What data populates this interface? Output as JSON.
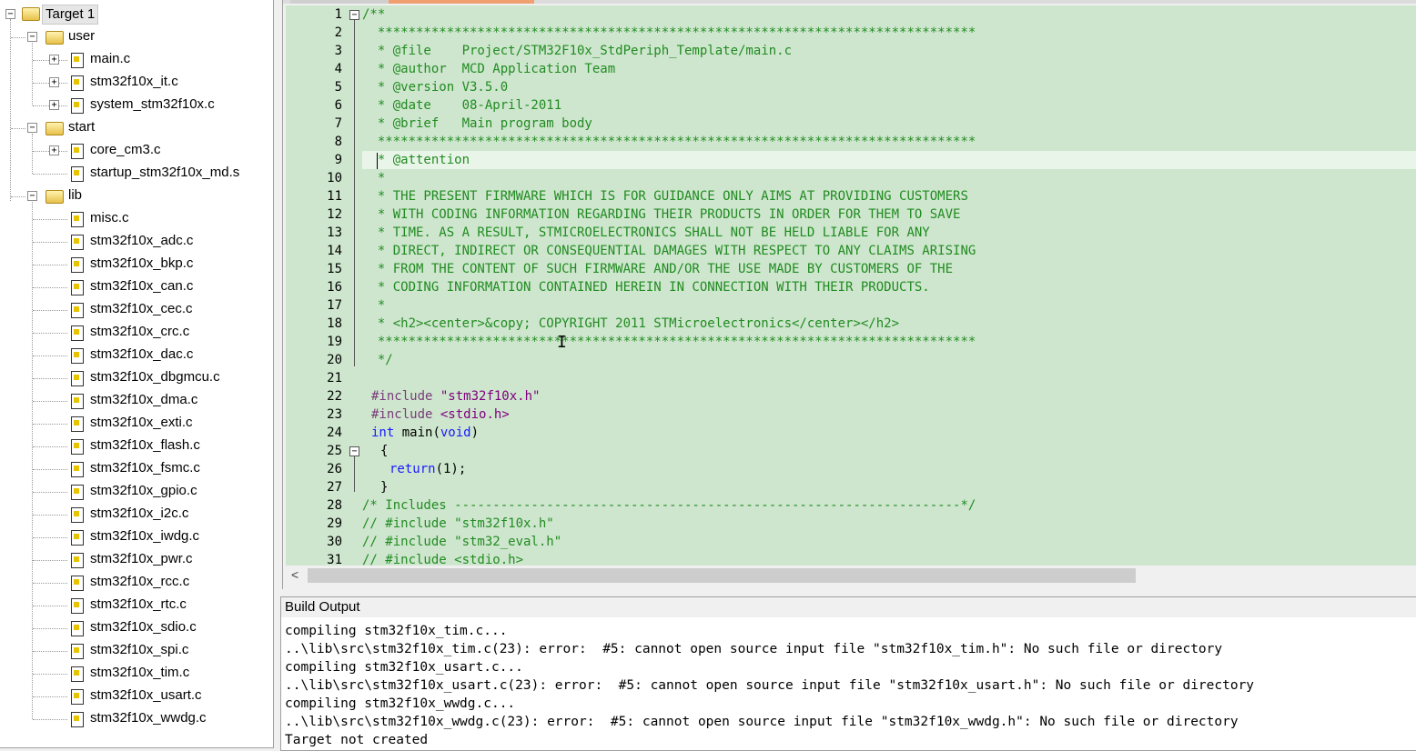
{
  "tree": {
    "root": "Target 1",
    "groups": [
      {
        "name": "user",
        "files": [
          "main.c",
          "stm32f10x_it.c",
          "system_stm32f10x.c"
        ]
      },
      {
        "name": "start",
        "files": [
          "core_cm3.c",
          "startup_stm32f10x_md.s"
        ]
      },
      {
        "name": "lib",
        "files": [
          "misc.c",
          "stm32f10x_adc.c",
          "stm32f10x_bkp.c",
          "stm32f10x_can.c",
          "stm32f10x_cec.c",
          "stm32f10x_crc.c",
          "stm32f10x_dac.c",
          "stm32f10x_dbgmcu.c",
          "stm32f10x_dma.c",
          "stm32f10x_exti.c",
          "stm32f10x_flash.c",
          "stm32f10x_fsmc.c",
          "stm32f10x_gpio.c",
          "stm32f10x_i2c.c",
          "stm32f10x_iwdg.c",
          "stm32f10x_pwr.c",
          "stm32f10x_rcc.c",
          "stm32f10x_rtc.c",
          "stm32f10x_sdio.c",
          "stm32f10x_spi.c",
          "stm32f10x_tim.c",
          "stm32f10x_usart.c",
          "stm32f10x_wwdg.c"
        ]
      }
    ]
  },
  "editor": {
    "lines": [
      "/**",
      "  ******************************************************************************",
      "  * @file    Project/STM32F10x_StdPeriph_Template/main.c",
      "  * @author  MCD Application Team",
      "  * @version V3.5.0",
      "  * @date    08-April-2011",
      "  * @brief   Main program body",
      "  ******************************************************************************",
      "  * @attention",
      "  *",
      "  * THE PRESENT FIRMWARE WHICH IS FOR GUIDANCE ONLY AIMS AT PROVIDING CUSTOMERS",
      "  * WITH CODING INFORMATION REGARDING THEIR PRODUCTS IN ORDER FOR THEM TO SAVE",
      "  * TIME. AS A RESULT, STMICROELECTRONICS SHALL NOT BE HELD LIABLE FOR ANY",
      "  * DIRECT, INDIRECT OR CONSEQUENTIAL DAMAGES WITH RESPECT TO ANY CLAIMS ARISING",
      "  * FROM THE CONTENT OF SUCH FIRMWARE AND/OR THE USE MADE BY CUSTOMERS OF THE",
      "  * CODING INFORMATION CONTAINED HEREIN IN CONNECTION WITH THEIR PRODUCTS.",
      "  *",
      "  * <h2><center>&copy; COPYRIGHT 2011 STMicroelectronics</center></h2>",
      "  ******************************************************************************",
      "  */",
      "",
      "",
      "",
      "",
      "",
      "",
      "",
      "/* Includes ------------------------------------------------------------------*/",
      "// #include \"stm32f10x.h\"",
      "// #include \"stm32_eval.h\"",
      "// #include <stdio.h>"
    ],
    "code": {
      "l22_pp": "#include",
      "l22_str": "\"stm32f10x.h\"",
      "l23_pp": "#include",
      "l23_str": "<stdio.h>",
      "l24_kw": "int",
      "l24_mid": " main(",
      "l24_kw2": "void",
      "l24_end": ")",
      "l25": "{",
      "l26_kw": "return",
      "l26_end": "(1);",
      "l27": "}"
    },
    "scroll_left": "<"
  },
  "build": {
    "title": "Build Output",
    "lines": [
      "compiling stm32f10x_tim.c...",
      "..\\lib\\src\\stm32f10x_tim.c(23): error:  #5: cannot open source input file \"stm32f10x_tim.h\": No such file or directory",
      "compiling stm32f10x_usart.c...",
      "..\\lib\\src\\stm32f10x_usart.c(23): error:  #5: cannot open source input file \"stm32f10x_usart.h\": No such file or directory",
      "compiling stm32f10x_wwdg.c...",
      "..\\lib\\src\\stm32f10x_wwdg.c(23): error:  #5: cannot open source input file \"stm32f10x_wwdg.h\": No such file or directory",
      "Target not created"
    ]
  }
}
